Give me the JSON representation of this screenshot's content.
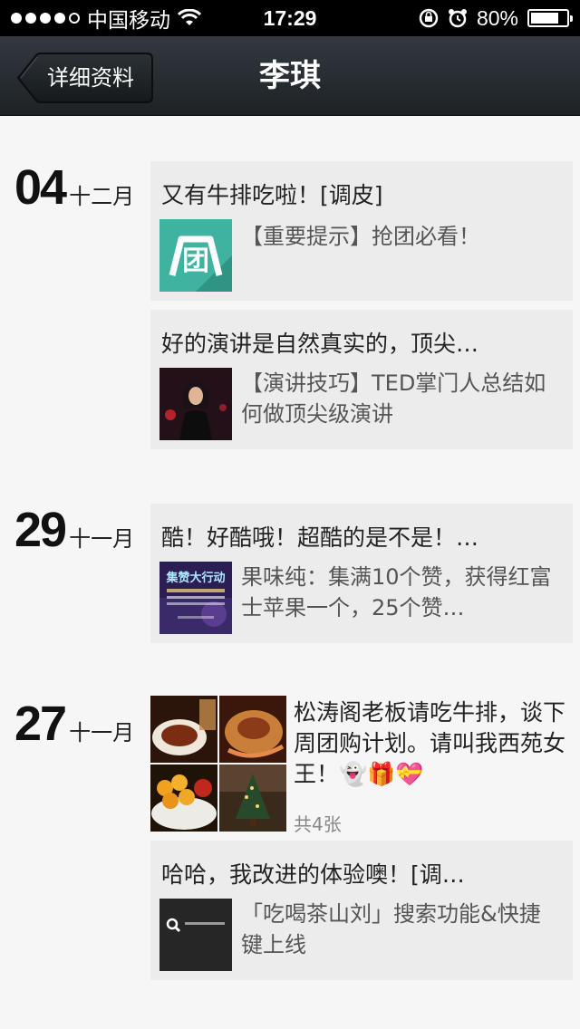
{
  "status_bar": {
    "carrier": "中国移动",
    "time": "17:29",
    "battery": "80%",
    "battery_level": 0.8
  },
  "nav": {
    "back_label": "详细资料",
    "title": "李琪"
  },
  "groups": [
    {
      "day": "04",
      "month": "十二月",
      "posts": [
        {
          "text": "又有牛排吃啦！[调皮]",
          "share_title": "【重要提示】抢团必看！",
          "thumb_label": "团"
        },
        {
          "text": "好的演讲是自然真实的，顶尖…",
          "share_title": "【演讲技巧】TED掌门人总结如何做顶尖级演讲"
        }
      ]
    },
    {
      "day": "29",
      "month": "十一月",
      "posts": [
        {
          "text": "酷！好酷哦！超酷的是不是！…",
          "share_title": "果味纯：集满10个赞，获得红富士苹果一个，25个赞…",
          "thumb_label": "集赞大行动"
        }
      ]
    },
    {
      "day": "27",
      "month": "十一月",
      "photo_post": {
        "text": "松涛阁老板请吃牛排，谈下周团购计划。请叫我西苑女王！👻🎁💝",
        "count": "共4张"
      },
      "posts": [
        {
          "text": "哈哈，我改进的体验噢！[调…",
          "share_title": "「吃喝茶山刘」搜索功能&快捷键上线"
        }
      ]
    }
  ]
}
